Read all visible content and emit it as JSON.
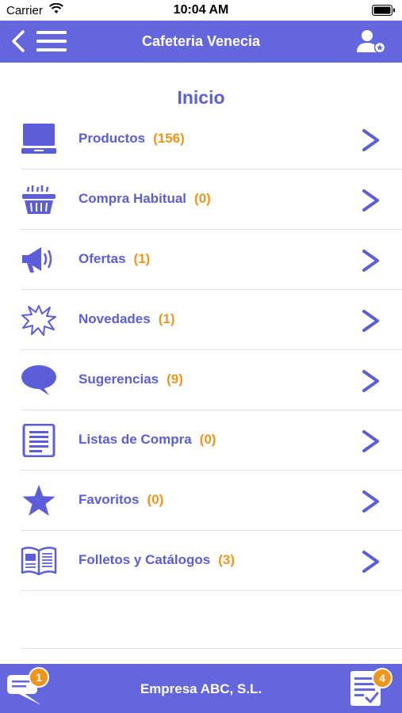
{
  "status_bar": {
    "carrier": "Carrier",
    "time": "10:04 AM"
  },
  "nav": {
    "title": "Cafeteria Venecia",
    "back_icon": "back-icon",
    "menu_icon": "hamburger-menu-icon",
    "user_icon": "user-profile-icon"
  },
  "page_title": "Inicio",
  "menu": [
    {
      "label": "Productos",
      "count": "(156)",
      "icon": "laptop-icon"
    },
    {
      "label": "Compra Habitual",
      "count": "(0)",
      "icon": "basket-icon"
    },
    {
      "label": "Ofertas",
      "count": "(1)",
      "icon": "megaphone-icon"
    },
    {
      "label": "Novedades",
      "count": "(1)",
      "icon": "starburst-icon"
    },
    {
      "label": "Sugerencias",
      "count": "(9)",
      "icon": "speech-bubble-icon"
    },
    {
      "label": "Listas de Compra",
      "count": "(0)",
      "icon": "list-document-icon"
    },
    {
      "label": "Favoritos",
      "count": "(0)",
      "icon": "star-icon"
    },
    {
      "label": "Folletos y Catálogos",
      "count": "(3)",
      "icon": "open-book-icon"
    }
  ],
  "footer": {
    "company": "Empresa ABC, S.L.",
    "messages_badge": "1",
    "orders_badge": "4"
  },
  "colors": {
    "primary": "#6366dc",
    "accent": "#f0951c",
    "text_primary": "#5b5ed8"
  }
}
